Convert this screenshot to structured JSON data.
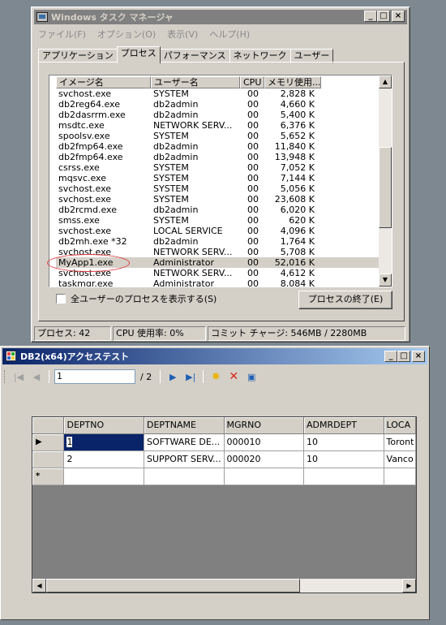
{
  "task_manager": {
    "title": "Windows タスク マネージャ",
    "menu": [
      "ファイル(F)",
      "オプション(O)",
      "表示(V)",
      "ヘルプ(H)"
    ],
    "tabs": [
      "アプリケーション",
      "プロセス",
      "パフォーマンス",
      "ネットワーク",
      "ユーザー"
    ],
    "active_tab": "プロセス",
    "columns": [
      "イメージ名",
      "ユーザー名",
      "CPU",
      "メモリ使用..."
    ],
    "rows": [
      [
        "svchost.exe",
        "SYSTEM",
        "00",
        "2,828 K"
      ],
      [
        "db2reg64.exe",
        "db2admin",
        "00",
        "4,660 K"
      ],
      [
        "db2dasrrm.exe",
        "db2admin",
        "00",
        "5,400 K"
      ],
      [
        "msdtc.exe",
        "NETWORK SERV...",
        "00",
        "6,376 K"
      ],
      [
        "spoolsv.exe",
        "SYSTEM",
        "00",
        "5,652 K"
      ],
      [
        "db2fmp64.exe",
        "db2admin",
        "00",
        "11,840 K"
      ],
      [
        "db2fmp64.exe",
        "db2admin",
        "00",
        "13,948 K"
      ],
      [
        "csrss.exe",
        "SYSTEM",
        "00",
        "7,052 K"
      ],
      [
        "mqsvc.exe",
        "SYSTEM",
        "00",
        "7,144 K"
      ],
      [
        "svchost.exe",
        "SYSTEM",
        "00",
        "5,056 K"
      ],
      [
        "svchost.exe",
        "SYSTEM",
        "00",
        "23,608 K"
      ],
      [
        "db2rcmd.exe",
        "db2admin",
        "00",
        "6,020 K"
      ],
      [
        "smss.exe",
        "SYSTEM",
        "00",
        "620 K"
      ],
      [
        "svchost.exe",
        "LOCAL SERVICE",
        "00",
        "4,096 K"
      ],
      [
        "db2mh.exe *32",
        "db2admin",
        "00",
        "1,764 K"
      ],
      [
        "svchost.exe",
        "NETWORK SERV...",
        "00",
        "5,708 K"
      ],
      [
        "MyApp1.exe",
        "Administrator",
        "00",
        "52,016 K"
      ],
      [
        "svchost.exe",
        "NETWORK SERV...",
        "00",
        "4,612 K"
      ],
      [
        "taskmgr.exe",
        "Administrator",
        "00",
        "8,084 K"
      ]
    ],
    "show_all_label": "全ユーザーのプロセスを表示する(S)",
    "end_process_label": "プロセスの終了(E)",
    "status": {
      "processes": "プロセス: 42",
      "cpu": "CPU 使用率: 0%",
      "commit": "コミット チャージ: 546MB / 2280MB"
    }
  },
  "db2_form": {
    "title": "DB2(x64)アクセステスト",
    "navigator": {
      "position": "1",
      "of_count": "/ 2"
    },
    "columns": [
      "DEPTNO",
      "DEPTNAME",
      "MGRNO",
      "ADMRDEPT",
      "LOCA"
    ],
    "rows": [
      [
        "1",
        "SOFTWARE DE...",
        "000010",
        "10",
        "Toront"
      ],
      [
        "2",
        "SUPPORT SERV...",
        "000020",
        "10",
        "Vanco"
      ]
    ],
    "new_row_marker": "*",
    "current_row_marker": "▶"
  }
}
